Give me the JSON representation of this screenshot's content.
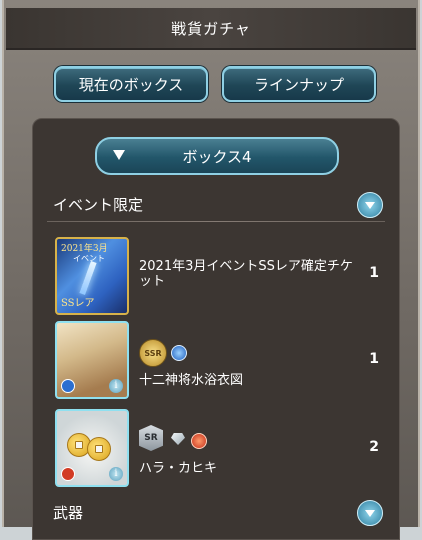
{
  "header": {
    "title": "戦貨ガチャ"
  },
  "tabs": {
    "box_label": "現在のボックス",
    "lineup_label": "ラインナップ"
  },
  "box_selector": {
    "label": "ボックス4"
  },
  "sections": [
    {
      "label": "イベント限定",
      "items": [
        {
          "name": "2021年3月イベントSSレア確定チケット",
          "quantity": "1",
          "thumb_text": {
            "year": "2021年3月",
            "word": "イベント",
            "ss": "SSレア"
          }
        },
        {
          "name": "十二神将水浴衣図",
          "quantity": "1",
          "rarity": "SSR",
          "element": "water"
        },
        {
          "name": "ハラ・カヒキ",
          "quantity": "2",
          "rarity": "SR",
          "element": "fire"
        }
      ]
    },
    {
      "label": "武器"
    }
  ],
  "colors": {
    "accent": "#8fd0e4",
    "panel": "#3c3632"
  },
  "icons": {
    "box_toggle": "triangle-down-icon",
    "section_toggle": "chevron-down-icon",
    "info": "info-icon"
  }
}
